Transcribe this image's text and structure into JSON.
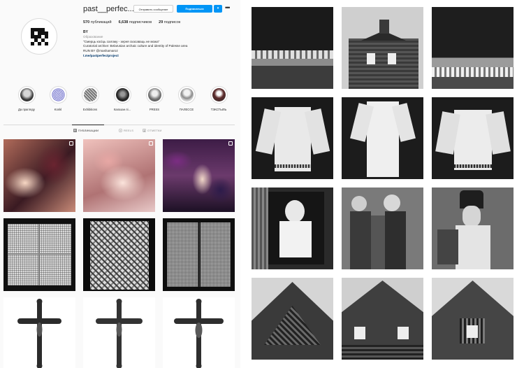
{
  "profile": {
    "username": "past__perfec...",
    "buttons": {
      "message": "Отправить сообщение",
      "follow": "Подписаться",
      "dropdown": "▾",
      "more": "•••"
    },
    "stats": {
      "posts_count": "570",
      "posts_label": "публикаций",
      "followers_count": "6,638",
      "followers_label": "подписчиков",
      "following_count": "29",
      "following_label": "подписок"
    },
    "bio": {
      "name": "BY",
      "category": "Образование",
      "line1": "\"Смерць косіць салому - зерня скасаваць не можа\"",
      "line2": "Curatorial archive: Belarusian archaic culture and identity of Palesse area",
      "line3": "RUN BY @mashamaroz",
      "link": "t.me/pastperfectproject"
    },
    "highlights": [
      "Да прагляду",
      "Konkl",
      "Exhibitions",
      "Калазан лі...",
      "PRESS",
      "ПАЛЕССЕ",
      "ТЭКСТЫЛЬ"
    ],
    "tabs": {
      "posts": "ПУБЛИКАЦИИ",
      "reels": "REELS",
      "tagged": "ОТМЕТКИ"
    }
  },
  "colors": {
    "accent": "#0095f6",
    "link": "#00376b",
    "muted": "#8e8e8e",
    "border": "#dbdbdb"
  }
}
